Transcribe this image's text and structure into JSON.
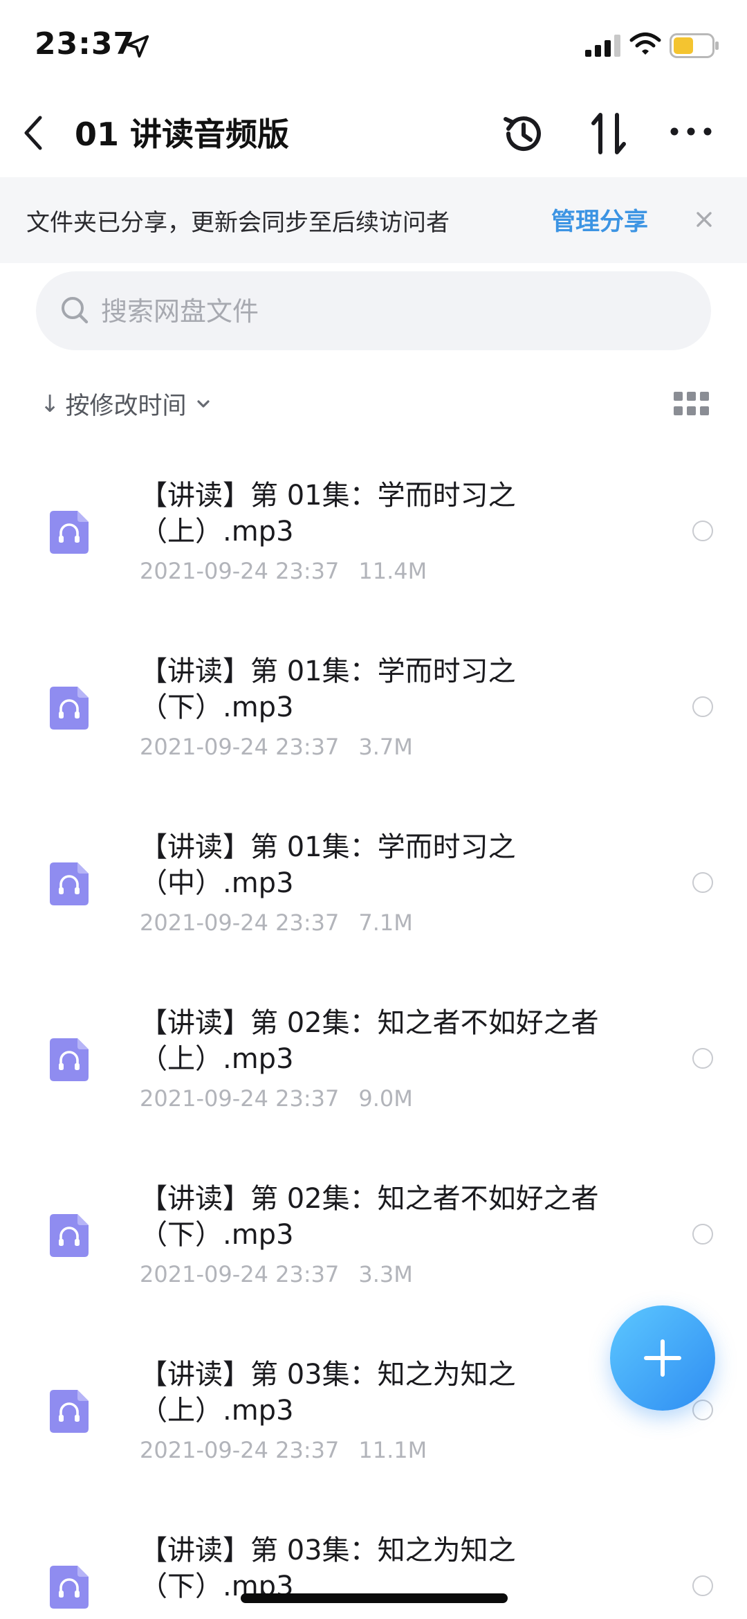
{
  "status_bar": {
    "time": "23:37",
    "icons": [
      "location-arrow-icon",
      "signal-icon",
      "wifi-icon",
      "battery-icon"
    ],
    "battery_color": "#f4c430"
  },
  "nav": {
    "title": "01 讲读音频版",
    "icons": [
      "back-icon",
      "history-icon",
      "sort-icon",
      "more-icon"
    ]
  },
  "share_banner": {
    "text": "文件夹已分享，更新会同步至后续访问者",
    "action": "管理分享",
    "close_icon": "close-icon",
    "action_color": "#3c94e3"
  },
  "search": {
    "placeholder": "搜索网盘文件",
    "value": ""
  },
  "sort": {
    "arrow": "↓",
    "label": "按修改时间"
  },
  "files": [
    {
      "name": "【讲读】第 01集：学而时习之（上）.mp3",
      "date": "2021-09-24 23:37",
      "size": "11.4M"
    },
    {
      "name": "【讲读】第 01集：学而时习之（下）.mp3",
      "date": "2021-09-24 23:37",
      "size": "3.7M"
    },
    {
      "name": "【讲读】第 01集：学而时习之（中）.mp3",
      "date": "2021-09-24 23:37",
      "size": "7.1M"
    },
    {
      "name": "【讲读】第 02集：知之者不如好之者（上）.mp3",
      "date": "2021-09-24 23:37",
      "size": "9.0M"
    },
    {
      "name": "【讲读】第 02集：知之者不如好之者（下）.mp3",
      "date": "2021-09-24 23:37",
      "size": "3.3M"
    },
    {
      "name": "【讲读】第 03集：知之为知之（上）.mp3",
      "date": "2021-09-24 23:37",
      "size": "11.1M"
    },
    {
      "name": "【讲读】第 03集：知之为知之（下）.mp3",
      "date": "",
      "size": ""
    }
  ],
  "file_icon": "audio-headphones-icon",
  "file_icon_color": "#8f8cf0",
  "fab": {
    "icon": "plus-icon",
    "color": "#3a9ef5"
  }
}
